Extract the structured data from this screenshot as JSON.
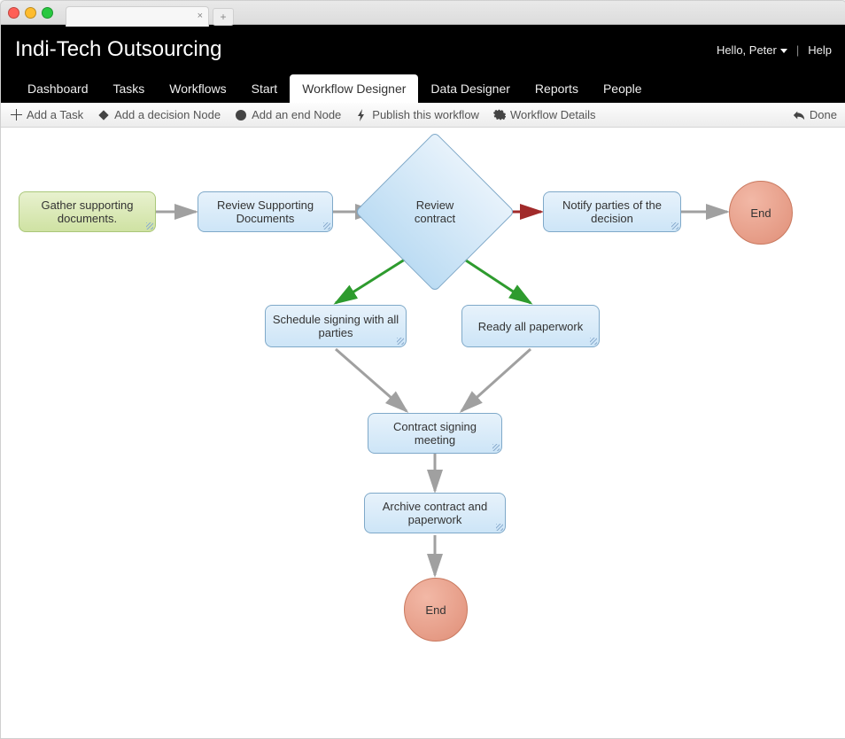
{
  "app": {
    "title": "Indi-Tech Outsourcing"
  },
  "user": {
    "greeting": "Hello, Peter",
    "help": "Help"
  },
  "nav": {
    "items": [
      {
        "label": "Dashboard"
      },
      {
        "label": "Tasks"
      },
      {
        "label": "Workflows"
      },
      {
        "label": "Start"
      },
      {
        "label": "Workflow Designer",
        "active": true
      },
      {
        "label": "Data Designer"
      },
      {
        "label": "Reports"
      },
      {
        "label": "People"
      }
    ]
  },
  "toolbar": {
    "add_task": "Add a Task",
    "add_decision": "Add a decision Node",
    "add_end": "Add an end Node",
    "publish": "Publish this workflow",
    "details": "Workflow Details",
    "done": "Done"
  },
  "workflow": {
    "nodes": {
      "gather": {
        "label": "Gather supporting documents.",
        "type": "start"
      },
      "review_docs": {
        "label": "Review Supporting Documents",
        "type": "task"
      },
      "review_contract": {
        "label": "Review contract",
        "type": "decision"
      },
      "notify": {
        "label": "Notify parties of the decision",
        "type": "task"
      },
      "end1": {
        "label": "End",
        "type": "end"
      },
      "schedule": {
        "label": "Schedule signing with all parties",
        "type": "task"
      },
      "ready": {
        "label": "Ready all paperwork",
        "type": "task"
      },
      "meeting": {
        "label": "Contract signing meeting",
        "type": "task"
      },
      "archive": {
        "label": "Archive contract and paperwork",
        "type": "task"
      },
      "end2": {
        "label": "End",
        "type": "end"
      }
    },
    "edges": [
      {
        "from": "gather",
        "to": "review_docs",
        "color": "gray"
      },
      {
        "from": "review_docs",
        "to": "review_contract",
        "color": "gray"
      },
      {
        "from": "review_contract",
        "to": "notify",
        "color": "red"
      },
      {
        "from": "notify",
        "to": "end1",
        "color": "gray"
      },
      {
        "from": "review_contract",
        "to": "schedule",
        "color": "green"
      },
      {
        "from": "review_contract",
        "to": "ready",
        "color": "green"
      },
      {
        "from": "schedule",
        "to": "meeting",
        "color": "gray"
      },
      {
        "from": "ready",
        "to": "meeting",
        "color": "gray"
      },
      {
        "from": "meeting",
        "to": "archive",
        "color": "gray"
      },
      {
        "from": "archive",
        "to": "end2",
        "color": "gray"
      }
    ]
  }
}
